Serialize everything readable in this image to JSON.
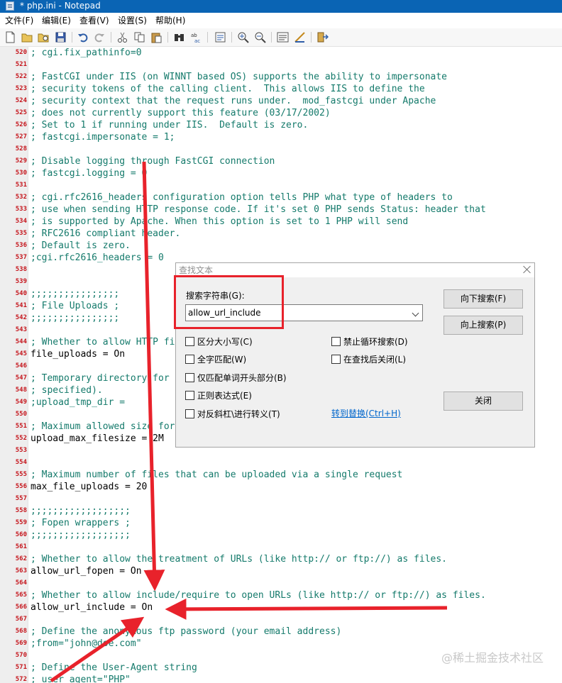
{
  "window": {
    "title": "* php.ini - Notepad"
  },
  "menu": [
    "文件(F)",
    "编辑(E)",
    "查看(V)",
    "设置(S)",
    "帮助(H)"
  ],
  "toolbar": {
    "buttons": [
      "new-icon",
      "open-icon",
      "open-folder-icon",
      "save-icon",
      "undo-icon",
      "redo-icon",
      "cut-icon",
      "copy-icon",
      "paste-icon",
      "find-icon",
      "replace-icon",
      "goto-icon",
      "zoom-in-icon",
      "zoom-out-icon",
      "word-wrap-icon",
      "settings-icon",
      "exit-icon"
    ]
  },
  "editor": {
    "lines": [
      {
        "n": "520",
        "text": "; cgi.fix_pathinfo=0",
        "kind": "comment"
      },
      {
        "n": "521",
        "text": "",
        "kind": "plain"
      },
      {
        "n": "522",
        "text": "; FastCGI under IIS (on WINNT based OS) supports the ability to impersonate",
        "kind": "comment"
      },
      {
        "n": "523",
        "text": "; security tokens of the calling client.  This allows IIS to define the",
        "kind": "comment"
      },
      {
        "n": "524",
        "text": "; security context that the request runs under.  mod_fastcgi under Apache",
        "kind": "comment"
      },
      {
        "n": "525",
        "text": "; does not currently support this feature (03/17/2002)",
        "kind": "comment"
      },
      {
        "n": "526",
        "text": "; Set to 1 if running under IIS.  Default is zero.",
        "kind": "comment"
      },
      {
        "n": "527",
        "text": "; fastcgi.impersonate = 1;",
        "kind": "comment"
      },
      {
        "n": "528",
        "text": "",
        "kind": "plain"
      },
      {
        "n": "529",
        "text": "; Disable logging through FastCGI connection",
        "kind": "comment"
      },
      {
        "n": "530",
        "text": "; fastcgi.logging = 0",
        "kind": "comment"
      },
      {
        "n": "531",
        "text": "",
        "kind": "plain"
      },
      {
        "n": "532",
        "text": "; cgi.rfc2616_headers configuration option tells PHP what type of headers to",
        "kind": "comment"
      },
      {
        "n": "533",
        "text": "; use when sending HTTP response code. If it's set 0 PHP sends Status: header that",
        "kind": "comment"
      },
      {
        "n": "534",
        "text": "; is supported by Apache. When this option is set to 1 PHP will send",
        "kind": "comment"
      },
      {
        "n": "535",
        "text": "; RFC2616 compliant header.",
        "kind": "comment"
      },
      {
        "n": "536",
        "text": "; Default is zero.",
        "kind": "comment"
      },
      {
        "n": "537",
        "text": ";cgi.rfc2616_headers = 0",
        "kind": "comment"
      },
      {
        "n": "538",
        "text": "",
        "kind": "plain"
      },
      {
        "n": "539",
        "text": "",
        "kind": "plain"
      },
      {
        "n": "540",
        "text": ";;;;;;;;;;;;;;;;",
        "kind": "comment"
      },
      {
        "n": "541",
        "text": "; File Uploads ;",
        "kind": "comment"
      },
      {
        "n": "542",
        "text": ";;;;;;;;;;;;;;;;",
        "kind": "comment"
      },
      {
        "n": "543",
        "text": "",
        "kind": "plain"
      },
      {
        "n": "544",
        "text": "; Whether to allow HTTP file uploads.",
        "kind": "comment"
      },
      {
        "n": "545",
        "text": "file_uploads = On",
        "kind": "plain"
      },
      {
        "n": "546",
        "text": "",
        "kind": "plain"
      },
      {
        "n": "547",
        "text": "; Temporary directory for HTTP uploaded files (will use system default if not",
        "kind": "comment"
      },
      {
        "n": "548",
        "text": "; specified).",
        "kind": "comment"
      },
      {
        "n": "549",
        "text": ";upload_tmp_dir =",
        "kind": "comment"
      },
      {
        "n": "550",
        "text": "",
        "kind": "plain"
      },
      {
        "n": "551",
        "text": "; Maximum allowed size for uploaded files.",
        "kind": "comment"
      },
      {
        "n": "552",
        "text": "upload_max_filesize = 2M",
        "kind": "plain"
      },
      {
        "n": "553",
        "text": "",
        "kind": "plain"
      },
      {
        "n": "554",
        "text": "",
        "kind": "plain"
      },
      {
        "n": "555",
        "text": "; Maximum number of files that can be uploaded via a single request",
        "kind": "comment"
      },
      {
        "n": "556",
        "text": "max_file_uploads = 20",
        "kind": "plain"
      },
      {
        "n": "557",
        "text": "",
        "kind": "plain"
      },
      {
        "n": "558",
        "text": ";;;;;;;;;;;;;;;;;;",
        "kind": "comment"
      },
      {
        "n": "559",
        "text": "; Fopen wrappers ;",
        "kind": "comment"
      },
      {
        "n": "560",
        "text": ";;;;;;;;;;;;;;;;;;",
        "kind": "comment"
      },
      {
        "n": "561",
        "text": "",
        "kind": "plain"
      },
      {
        "n": "562",
        "text": "; Whether to allow the treatment of URLs (like http:// or ftp://) as files.",
        "kind": "comment"
      },
      {
        "n": "563",
        "text": "allow_url_fopen = On",
        "kind": "plain"
      },
      {
        "n": "564",
        "text": "",
        "kind": "plain"
      },
      {
        "n": "565",
        "text": "; Whether to allow include/require to open URLs (like http:// or ftp://) as files.",
        "kind": "comment"
      },
      {
        "n": "566",
        "text": "allow_url_include = On",
        "kind": "plain"
      },
      {
        "n": "567",
        "text": "",
        "kind": "plain"
      },
      {
        "n": "568",
        "text": "; Define the anonymous ftp password (your email address)",
        "kind": "comment"
      },
      {
        "n": "569",
        "text": ";from=\"john@doe.com\"",
        "kind": "comment"
      },
      {
        "n": "570",
        "text": "",
        "kind": "plain"
      },
      {
        "n": "571",
        "text": "; Define the User-Agent string",
        "kind": "comment"
      },
      {
        "n": "572",
        "text": "; user_agent=\"PHP\"",
        "kind": "comment"
      }
    ]
  },
  "find_dialog": {
    "title": "查找文本",
    "search_label": "搜索字符串(G):",
    "search_value": "allow_url_include",
    "find_next": "向下搜索(F)",
    "find_prev": "向上搜索(P)",
    "close": "关闭",
    "options_left": [
      "区分大小写(C)",
      "全字匹配(W)",
      "仅匹配单词开头部分(B)",
      "正则表达式(E)",
      "对反斜杠\\进行转义(T)"
    ],
    "options_right": [
      "禁止循环搜索(D)",
      "在查找后关闭(L)"
    ],
    "goto_replace": "转到替换(Ctrl+H)"
  },
  "watermark": "@稀土掘金技术社区",
  "colors": {
    "line_number": "#c5141b",
    "comment": "#147a6b",
    "annotation": "#e8222b",
    "titlebar": "#0a64b4"
  }
}
